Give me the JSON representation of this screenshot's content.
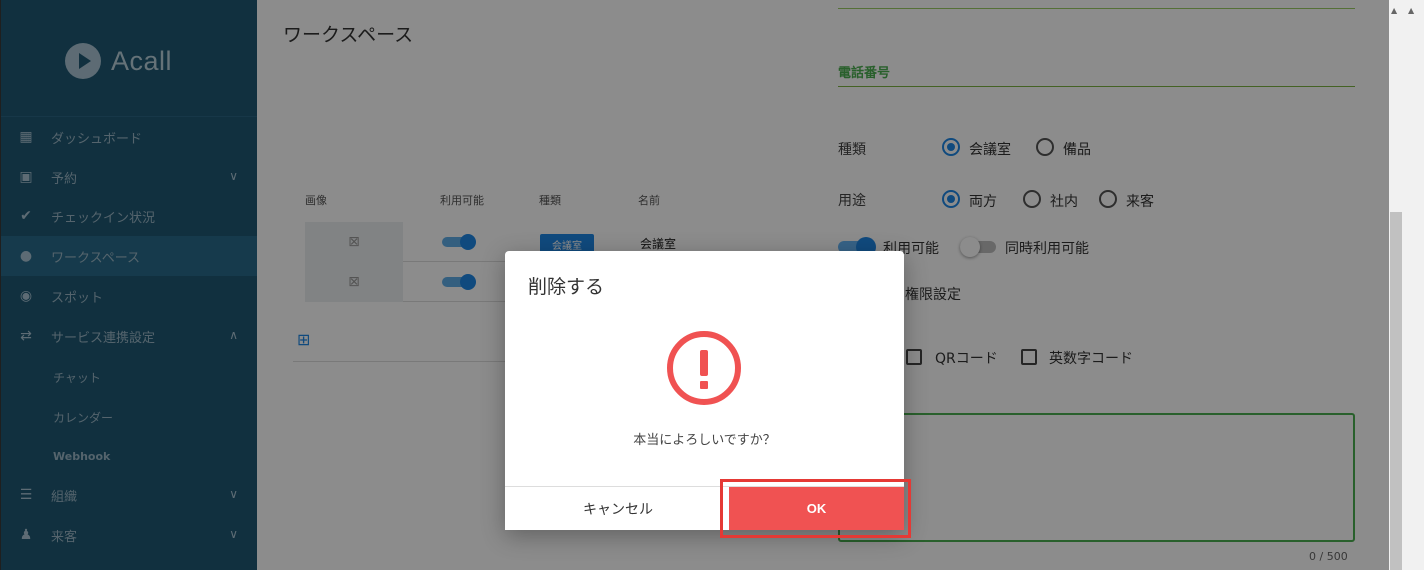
{
  "sidebar": {
    "logo": "Acall",
    "items": [
      {
        "label": "ダッシュボード",
        "icon": "dashboard-icon",
        "glyph": "▦"
      },
      {
        "label": "予約",
        "icon": "calendar-icon",
        "glyph": "▣",
        "chevron": "∨"
      },
      {
        "label": "チェックイン状況",
        "icon": "check-icon",
        "glyph": "✔"
      },
      {
        "label": "ワークスペース",
        "icon": "location-pin-icon",
        "glyph": "●"
      },
      {
        "label": "スポット",
        "icon": "spot-icon",
        "glyph": "◉"
      },
      {
        "label": "サービス連携設定",
        "icon": "integration-icon",
        "glyph": "⇄",
        "chevron": "∧"
      },
      {
        "label": "組織",
        "icon": "group-icon",
        "glyph": "☰",
        "chevron": "∨"
      },
      {
        "label": "来客",
        "icon": "visitor-icon",
        "glyph": "♟",
        "chevron": "∨"
      }
    ],
    "sub_items": [
      "チャット",
      "カレンダー",
      "Webhook"
    ]
  },
  "main": {
    "title": "ワークスペース",
    "headers": [
      "画像",
      "利用可能",
      "種類",
      "名前"
    ],
    "rows": [
      {
        "type": "会議室",
        "name": "会議室"
      },
      {
        "type": "",
        "name": ""
      }
    ],
    "image_placeholder_glyph": "⊠",
    "grid_glyph": "⊞"
  },
  "panel": {
    "phone_label": "電話番号",
    "kind_label": "種類",
    "kind_options": [
      "会議室",
      "備品"
    ],
    "purpose_label": "用途",
    "purpose_options": [
      "両方",
      "社内",
      "来客"
    ],
    "available_label": "利用可能",
    "concurrent_label": "同時利用可能",
    "permission_label": "用権限設定",
    "code_options": [
      "QRコード",
      "英数字コード"
    ],
    "counter": "0 / 500"
  },
  "dialog": {
    "title": "削除する",
    "message": "本当によろしいですか？",
    "cancel_label": "キャンセル",
    "ok_label": "OK"
  },
  "colors": {
    "sidebar": "#1f5873",
    "accent": "#1e88e5",
    "danger": "#f05252",
    "green": "#4caf50"
  }
}
